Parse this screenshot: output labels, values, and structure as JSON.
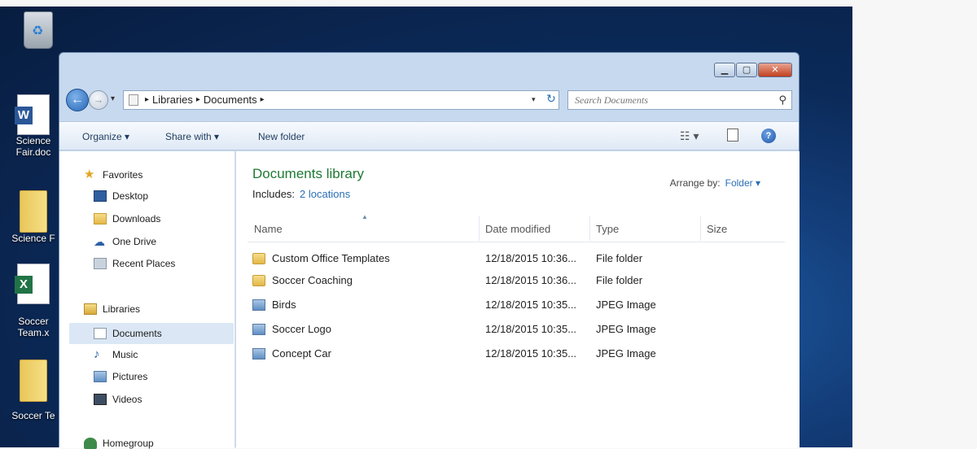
{
  "desktop": {
    "icons": [
      {
        "name": "recycle-bin",
        "label": ""
      },
      {
        "name": "science-fair-doc",
        "label_line1": "Science",
        "label_line2": "Fair.doc"
      },
      {
        "name": "science-fair-folder",
        "label_line1": "Science F"
      },
      {
        "name": "soccer-team-xls",
        "label_line1": "Soccer",
        "label_line2": "Team.x"
      },
      {
        "name": "soccer-team-folder",
        "label_line1": "Soccer Te"
      }
    ]
  },
  "window": {
    "controls": {
      "minimize": "▁",
      "maximize": "▢",
      "close": "✕"
    },
    "address": {
      "libraries": "Libraries",
      "documents": "Documents"
    },
    "search": {
      "placeholder": "Search Documents"
    },
    "toolbar": {
      "organize": "Organize ▾",
      "share_with": "Share with ▾",
      "new_folder": "New folder",
      "view_icon": "☷ ▾",
      "help_icon": "?"
    },
    "nav_pane": {
      "favorites": {
        "label": "Favorites",
        "items": [
          "Desktop",
          "Downloads",
          "One Drive",
          "Recent Places"
        ]
      },
      "libraries": {
        "label": "Libraries",
        "items": [
          "Documents",
          "Music",
          "Pictures",
          "Videos"
        ]
      },
      "homegroup": "Homegroup"
    },
    "content": {
      "title": "Documents library",
      "includes_label": "Includes:",
      "includes_link": "2 locations",
      "arrange_label": "Arrange by:",
      "arrange_value": "Folder ▾",
      "columns": {
        "name": "Name",
        "date": "Date modified",
        "type": "Type",
        "size": "Size"
      },
      "rows": [
        {
          "name": "Custom Office Templates",
          "date": "12/18/2015 10:36...",
          "type": "File folder",
          "kind": "folder"
        },
        {
          "name": "Soccer Coaching",
          "date": "12/18/2015 10:36...",
          "type": "File folder",
          "kind": "folder"
        },
        {
          "name": "Birds",
          "date": "12/18/2015 10:35...",
          "type": "JPEG Image",
          "kind": "image"
        },
        {
          "name": "Soccer Logo",
          "date": "12/18/2015 10:35...",
          "type": "JPEG Image",
          "kind": "image"
        },
        {
          "name": "Concept Car",
          "date": "12/18/2015 10:35...",
          "type": "JPEG Image",
          "kind": "image"
        }
      ]
    }
  },
  "colors": {
    "library_title": "#1f7a33",
    "link": "#2b6fb6",
    "selected_bg": "#dbe7f5"
  }
}
